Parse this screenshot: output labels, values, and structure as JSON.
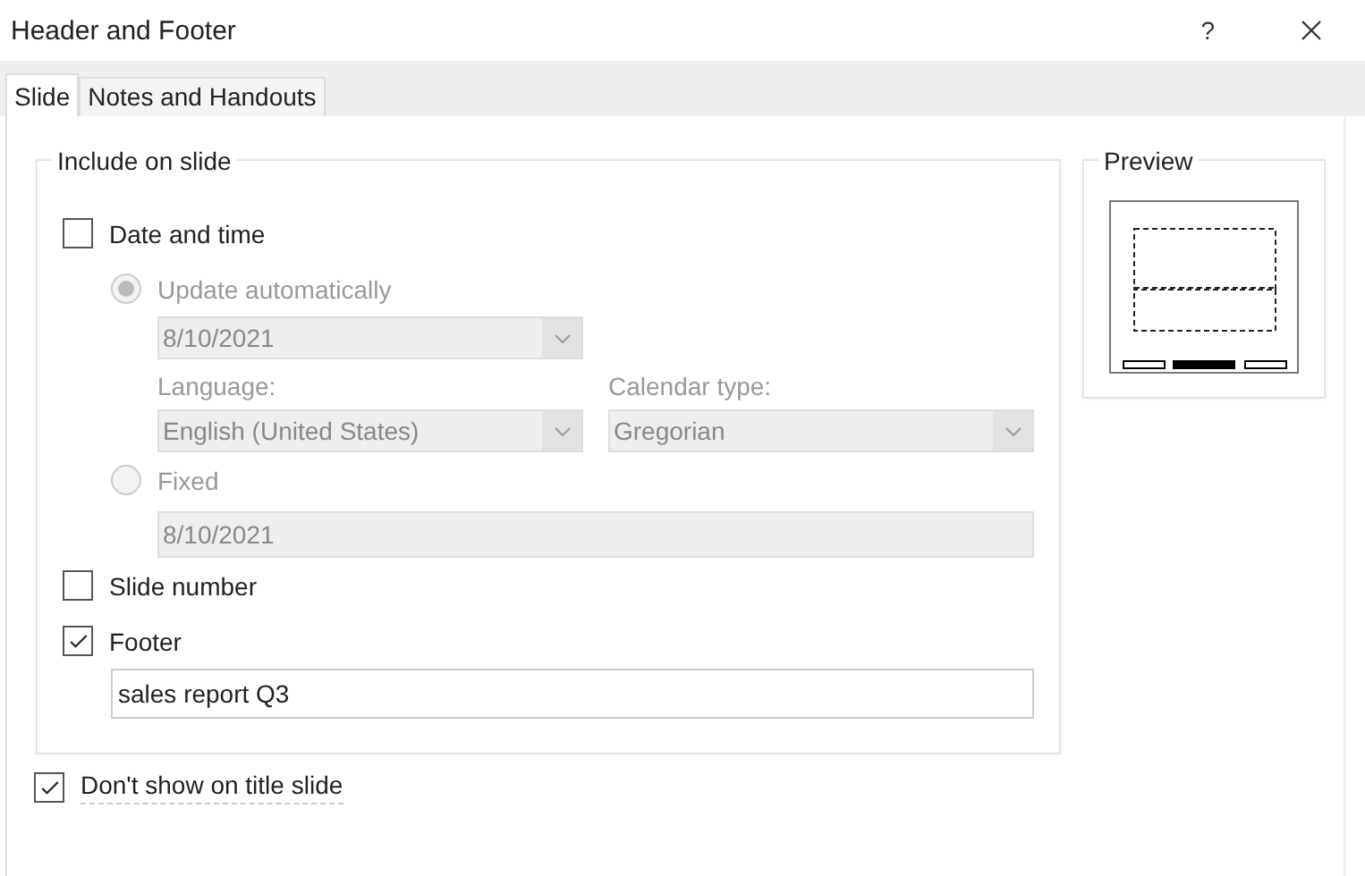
{
  "window": {
    "title": "Header and Footer",
    "help": "?"
  },
  "tabs": [
    {
      "label": "Slide",
      "selected": true
    },
    {
      "label": "Notes and Handouts",
      "selected": false
    }
  ],
  "include_group": {
    "title": "Include on slide",
    "date_time": {
      "label": "Date and time",
      "checked": false,
      "update_automatically": {
        "label": "Update automatically",
        "selected": true
      },
      "date_dropdown": {
        "value": "8/10/2021"
      },
      "language": {
        "label": "Language:",
        "value": "English (United States)"
      },
      "calendar_type": {
        "label": "Calendar type:",
        "value": "Gregorian"
      },
      "fixed": {
        "label": "Fixed",
        "selected": false
      },
      "fixed_field": {
        "value": "8/10/2021"
      }
    },
    "slide_number": {
      "label": "Slide number",
      "checked": false
    },
    "footer": {
      "label": "Footer",
      "checked": true,
      "value": "sales report Q3"
    }
  },
  "dont_show_on_title_slide": {
    "label": "Don't show on title slide",
    "checked": true
  },
  "preview": {
    "title": "Preview"
  }
}
